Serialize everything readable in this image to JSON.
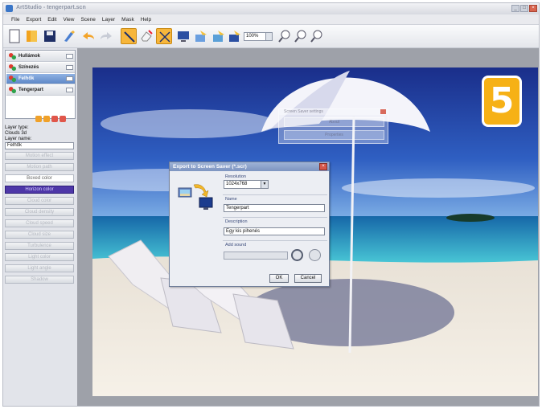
{
  "window": {
    "title": "ArtStudio - tengerpart.scn"
  },
  "menu": [
    "File",
    "Export",
    "Edit",
    "View",
    "Scene",
    "Layer",
    "Mask",
    "Help"
  ],
  "toolbar": {
    "zoom_value": "100%",
    "selected_tool_color": "#f7b63b"
  },
  "layers": [
    {
      "name": "Hullámok",
      "selected": false
    },
    {
      "name": "Színezés",
      "selected": false
    },
    {
      "name": "Felhők",
      "selected": true
    },
    {
      "name": "Tengerpart",
      "selected": false
    }
  ],
  "properties": {
    "layer_type_label": "Layer type:",
    "layer_type_value": "Clouds 3d",
    "layer_name_label": "Layer name:",
    "layer_name_value": "Felhők",
    "buttons": [
      {
        "label": "Motion effect",
        "style": "disabled"
      },
      {
        "label": "Motion path",
        "style": "disabled"
      },
      {
        "label": "Boxed color",
        "style": "white"
      },
      {
        "label": "Horizon color",
        "style": "purple"
      },
      {
        "label": "Cloud color",
        "style": "disabled"
      },
      {
        "label": "Cloud density",
        "style": "disabled"
      },
      {
        "label": "Cloud speed",
        "style": "disabled"
      },
      {
        "label": "Cloud size",
        "style": "disabled"
      },
      {
        "label": "Turbulence",
        "style": "disabled"
      },
      {
        "label": "Light color",
        "style": "disabled"
      },
      {
        "label": "Light angle",
        "style": "disabled"
      },
      {
        "label": "Shadow",
        "style": "disabled"
      }
    ]
  },
  "badge": {
    "number": "5",
    "color": "#f6b116"
  },
  "ghost_dialog": {
    "title": "Screen Saver settings",
    "buttons": [
      "About",
      "Properties"
    ]
  },
  "export_dialog": {
    "title": "Export to Screen Saver (*.scr)",
    "resolution_label": "Resolution",
    "resolution_value": "1024x768",
    "name_label": "Name",
    "name_value": "Tengerpart",
    "description_label": "Description",
    "description_value": "Egy kis pihenés",
    "sound_label": "Add sound",
    "ok_label": "OK",
    "cancel_label": "Cancel"
  }
}
